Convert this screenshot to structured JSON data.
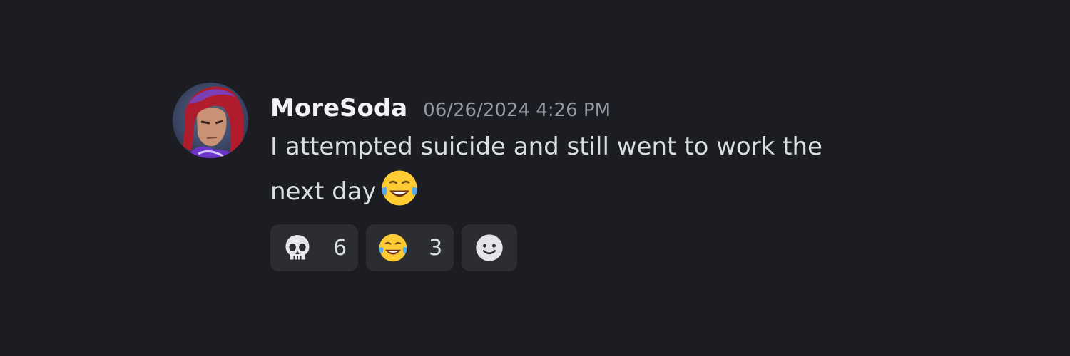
{
  "message": {
    "author": "MoreSoda",
    "timestamp": "06/26/2024 4:26 PM",
    "text": "I attempted suicide and still went to work the next day",
    "inline_emoji": "face-with-tears-of-joy"
  },
  "reactions": [
    {
      "emoji": "skull",
      "count": "6"
    },
    {
      "emoji": "face-with-tears-of-joy",
      "count": "3"
    }
  ],
  "add_reaction": {
    "icon": "add-reaction-smiley"
  },
  "colors": {
    "background": "#1c1d22",
    "reaction_bg": "#2b2d31",
    "username": "#f2f3f5",
    "timestamp": "#949ba4",
    "text": "#dbdee1"
  }
}
